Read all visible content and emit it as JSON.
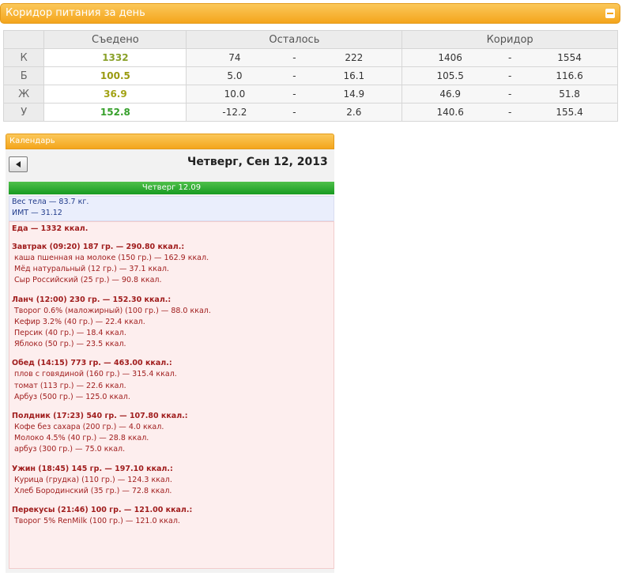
{
  "corridor": {
    "title": "Коридор питания за день",
    "headers": {
      "eaten": "Съедено",
      "remaining": "Осталось",
      "corridor": "Коридор"
    },
    "rows": [
      {
        "label": "К",
        "eaten": "1332",
        "rem_min": "74",
        "rem_max": "222",
        "cor_min": "1406",
        "cor_max": "1554"
      },
      {
        "label": "Б",
        "eaten": "100.5",
        "rem_min": "5.0",
        "rem_max": "16.1",
        "cor_min": "105.5",
        "cor_max": "116.6"
      },
      {
        "label": "Ж",
        "eaten": "36.9",
        "rem_min": "10.0",
        "rem_max": "14.9",
        "cor_min": "46.9",
        "cor_max": "51.8"
      },
      {
        "label": "У",
        "eaten": "152.8",
        "rem_min": "-12.2",
        "rem_max": "2.6",
        "cor_min": "140.6",
        "cor_max": "155.4"
      }
    ],
    "dash": "-"
  },
  "calendar": {
    "title": "Календарь",
    "date_title": "Четверг, Сен 12, 2013",
    "day_label": "Четверг 12.09",
    "weight": "Вес тела — 83.7 кг.",
    "bmi": "ИМТ — 31.12",
    "food_total": "Еда — 1332 ккал.",
    "meals": [
      {
        "title": "Завтрак (09:20) 187 гр. — 290.80 ккал.:",
        "items": [
          "каша пшенная на молоке (150 гр.) — 162.9 ккал.",
          "Мёд натуральный (12 гр.) — 37.1 ккал.",
          "Сыр Российский (25 гр.) — 90.8 ккал."
        ]
      },
      {
        "title": "Ланч (12:00) 230 гр. — 152.30 ккал.:",
        "items": [
          "Творог 0.6% (маложирный) (100 гр.) — 88.0 ккал.",
          "Кефир 3.2% (40 гр.) — 22.4 ккал.",
          "Персик (40 гр.) — 18.4 ккал.",
          "Яблоко (50 гр.) — 23.5 ккал."
        ]
      },
      {
        "title": "Обед (14:15) 773 гр. — 463.00 ккал.:",
        "items": [
          "плов с говядиной (160 гр.) — 315.4 ккал.",
          "томат (113 гр.) — 22.6 ккал.",
          "Арбуз (500 гр.) — 125.0 ккал."
        ]
      },
      {
        "title": "Полдник (17:23) 540 гр. — 107.80 ккал.:",
        "items": [
          "Кофе без сахара (200 гр.) — 4.0 ккал.",
          "Молоко 4.5% (40 гр.) — 28.8 ккал.",
          "арбуз (300 гр.) — 75.0 ккал."
        ]
      },
      {
        "title": "Ужин (18:45) 145 гр. — 197.10 ккал.:",
        "items": [
          "Курица (грудка) (110 гр.) — 124.3 ккал.",
          "Хлеб Бородинский (35 гр.) — 72.8 ккал."
        ]
      },
      {
        "title": "Перекусы (21:46) 100 гр. — 121.00 ккал.:",
        "items": [
          "Творог 5% RenMilk (100 гр.) — 121.0 ккал."
        ]
      }
    ]
  }
}
